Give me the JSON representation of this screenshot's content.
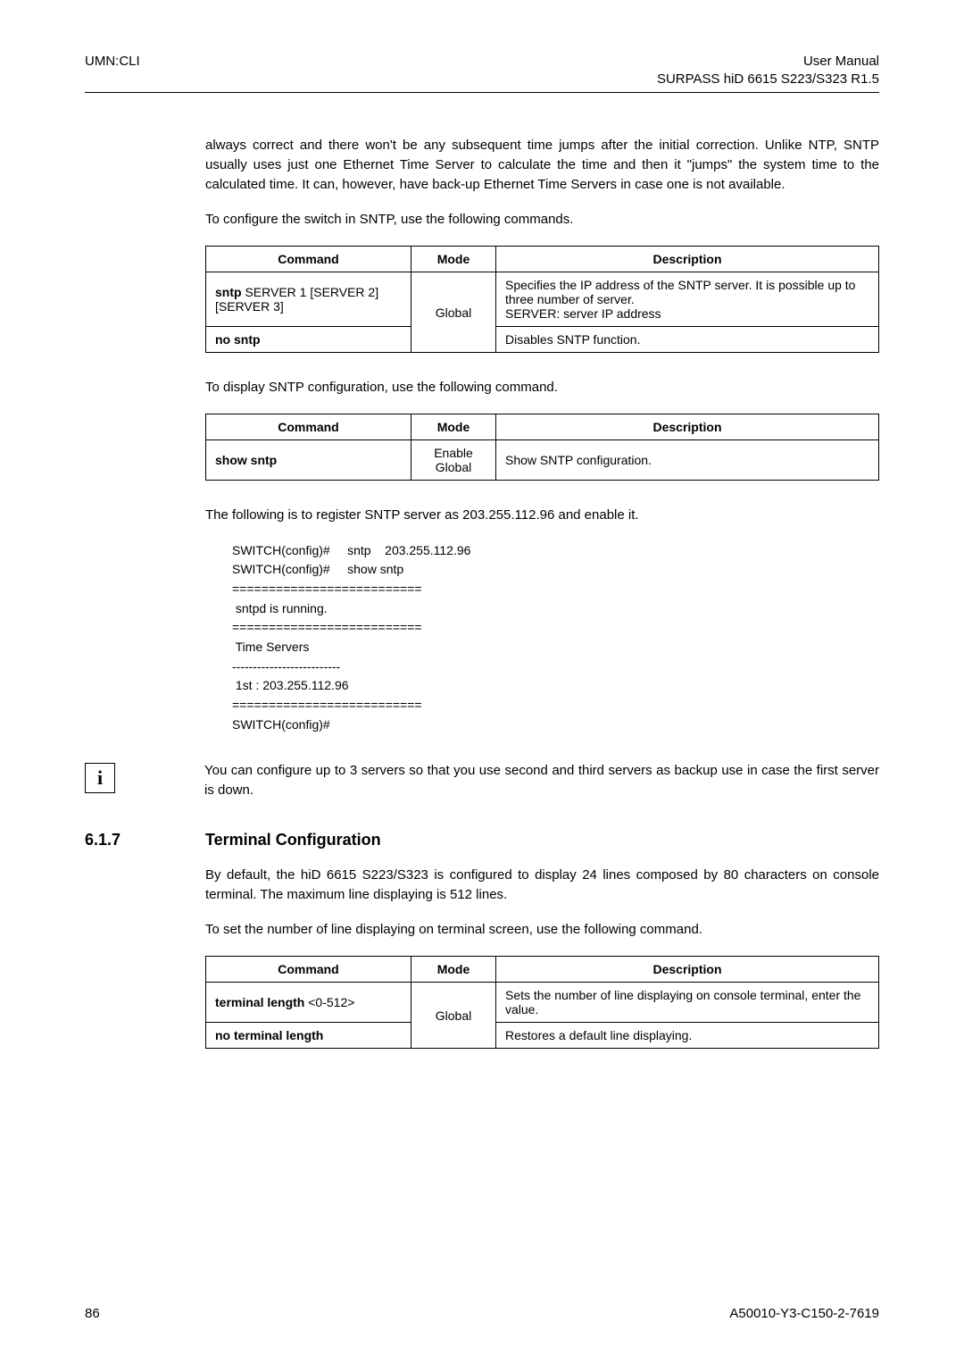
{
  "header": {
    "left": "UMN:CLI",
    "rightTop": "User Manual",
    "rightSub": "SURPASS hiD 6615 S223/S323 R1.5"
  },
  "para1": "always correct and there won't be any subsequent time jumps after the initial correction. Unlike NTP, SNTP usually uses just one Ethernet Time Server to calculate the time and then it \"jumps\" the system time to the calculated time. It can, however, have back-up Ethernet Time Servers in case one is not available.",
  "para2": "To configure the switch in SNTP, use the following commands.",
  "table1": {
    "headers": {
      "c1": "Command",
      "c2": "Mode",
      "c3": "Description"
    },
    "r1c1a": "sntp",
    "r1c1b": " SERVER 1 [SERVER 2] [SERVER 3]",
    "r1c2": "Global",
    "r1c3": "Specifies the IP address of the SNTP server. It is possible up to three number of server.\nSERVER: server IP address",
    "r2c1": "no sntp",
    "r2c3": "Disables SNTP function."
  },
  "para3": "To display SNTP configuration, use the following command.",
  "table2": {
    "headers": {
      "c1": "Command",
      "c2": "Mode",
      "c3": "Description"
    },
    "r1c1": "show sntp",
    "r1c2": "Enable\nGlobal",
    "r1c3": "Show SNTP configuration."
  },
  "para4": "The following is to register SNTP server as 203.255.112.96 and enable it.",
  "code": "SWITCH(config)#     sntp    203.255.112.96\nSWITCH(config)#     show sntp\n==========================\n sntpd is running.\n==========================\n Time Servers\n--------------------------\n 1st : 203.255.112.96\n==========================\nSWITCH(config)#",
  "info": {
    "iconLabel": "i",
    "text": "You can configure up to 3 servers so that you use second and third servers as backup use in case the first server is down."
  },
  "section": {
    "num": "6.1.7",
    "title": "Terminal Configuration"
  },
  "para5": "By default, the hiD 6615 S223/S323 is configured to display 24 lines composed by 80 characters on console terminal. The maximum line displaying is 512 lines.",
  "para6": "To set the number of line displaying on terminal screen, use the following command.",
  "table3": {
    "headers": {
      "c1": "Command",
      "c2": "Mode",
      "c3": "Description"
    },
    "r1c1a": "terminal length",
    "r1c1b": " <0-512>",
    "r1c2": "Global",
    "r1c3": "Sets the number of line displaying on console terminal, enter the value.",
    "r2c1": "no terminal length",
    "r2c3": "Restores a default line displaying."
  },
  "footer": {
    "left": "86",
    "right": "A50010-Y3-C150-2-7619"
  }
}
